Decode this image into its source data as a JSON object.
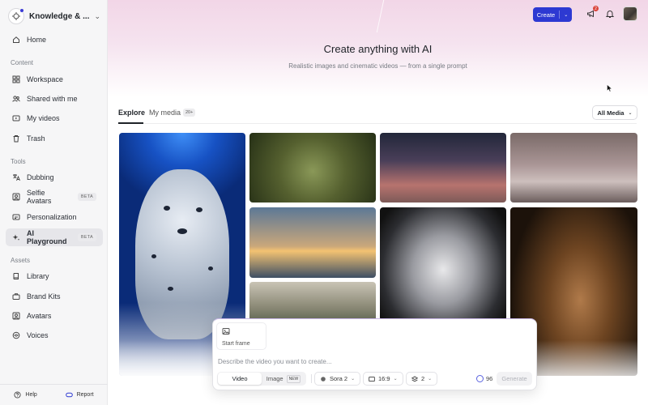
{
  "workspace": {
    "name": "Knowledge & ..."
  },
  "sidebar": {
    "home": "Home",
    "content_label": "Content",
    "content": [
      "Workspace",
      "Shared with me",
      "My videos",
      "Trash"
    ],
    "tools_label": "Tools",
    "tools": [
      {
        "label": "Dubbing",
        "badge": ""
      },
      {
        "label": "Selfie Avatars",
        "badge": "BETA"
      },
      {
        "label": "Personalization",
        "badge": ""
      },
      {
        "label": "AI Playground",
        "badge": "BETA",
        "active": true
      }
    ],
    "assets_label": "Assets",
    "assets": [
      "Library",
      "Brand Kits",
      "Avatars",
      "Voices"
    ],
    "help": "Help",
    "report": "Report"
  },
  "topbar": {
    "create_label": "Create",
    "notification_count": "2"
  },
  "hero": {
    "title": "Create anything with AI",
    "subtitle": "Realistic images and cinematic videos — from a single prompt"
  },
  "tabs": [
    {
      "label": "Explore",
      "active": true
    },
    {
      "label": "My media",
      "badge": "20+"
    }
  ],
  "filter": {
    "selected": "All Media"
  },
  "gallery": [
    "snow leopard",
    "tree face",
    "neon city street",
    "stone bridge",
    "futuristic train",
    "metal mask",
    "wooden carving",
    "misty mountains"
  ],
  "composer": {
    "start_frame": "Start frame",
    "placeholder": "Describe the video you want to create...",
    "mode_video": "Video",
    "mode_image": "Image",
    "image_badge": "NEW",
    "model": "Sora 2",
    "aspect": "16:9",
    "count": "2",
    "credits": "96",
    "generate": "Generate"
  },
  "colors": {
    "accent": "#2d39d2",
    "notification": "#d9433a"
  }
}
